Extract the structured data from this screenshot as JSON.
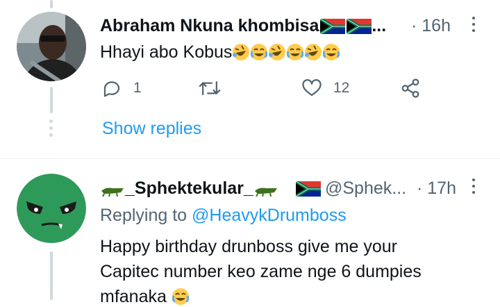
{
  "tweet1": {
    "author": "Abraham Nkuna khombisa",
    "author_suffix": "...",
    "separator": "·",
    "time": "16h",
    "text": "Hhayi abo Kobus",
    "reply_count": "1",
    "like_count": "12",
    "show_replies": "Show replies"
  },
  "tweet2": {
    "author": "_Sphektekular_",
    "handle": "@Sphek...",
    "separator": "·",
    "time": "17h",
    "replying_prefix": "Replying to",
    "replying_handle": "@HeavykDrumboss",
    "text_line1": "Happy birthday drunboss give me your",
    "text_line2": "Capitec number keo zame nge 6 dumpies",
    "text_line3": "mfanaka"
  },
  "colors": {
    "accent": "#1d9bf0",
    "secondary_text": "#536471",
    "divider": "#eff3f4",
    "avatar_green": "#2e9a59"
  }
}
